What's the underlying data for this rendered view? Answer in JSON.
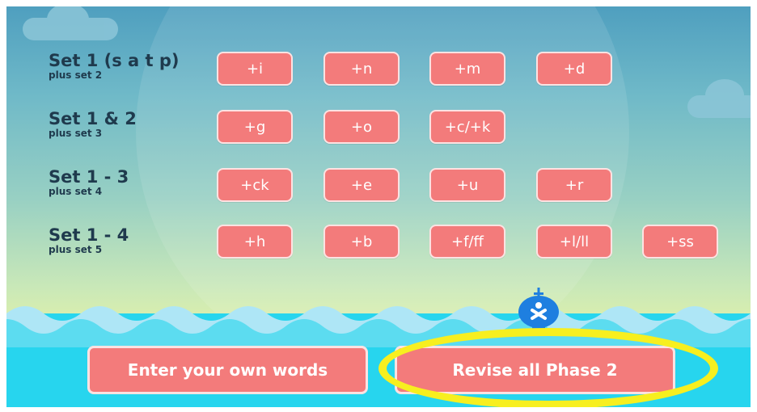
{
  "sets": [
    {
      "title": "Set 1 (s a t p)",
      "subtitle": "plus set 2",
      "buttons": [
        "+i",
        "+n",
        "+m",
        "+d"
      ]
    },
    {
      "title": "Set 1 & 2",
      "subtitle": "plus set 3",
      "buttons": [
        "+g",
        "+o",
        "+c/+k"
      ]
    },
    {
      "title": "Set 1 - 3",
      "subtitle": "plus set 4",
      "buttons": [
        "+ck",
        "+e",
        "+u",
        "+r"
      ]
    },
    {
      "title": "Set 1 - 4",
      "subtitle": "plus set 5",
      "buttons": [
        "+h",
        "+b",
        "+f/ff",
        "+l/ll",
        "+ss"
      ]
    }
  ],
  "actions": {
    "enter_words": "Enter your own words",
    "revise_all": "Revise all Phase 2"
  },
  "colors": {
    "button": "#f37b7b",
    "button_border": "#fde2e2",
    "label": "#1f3a4d",
    "sea": "#27d5ee",
    "highlight": "#f7ef1f",
    "boat": "#1e7fe0"
  },
  "icons": {
    "boat": "boat-icon",
    "cloud": "cloud-icon"
  }
}
